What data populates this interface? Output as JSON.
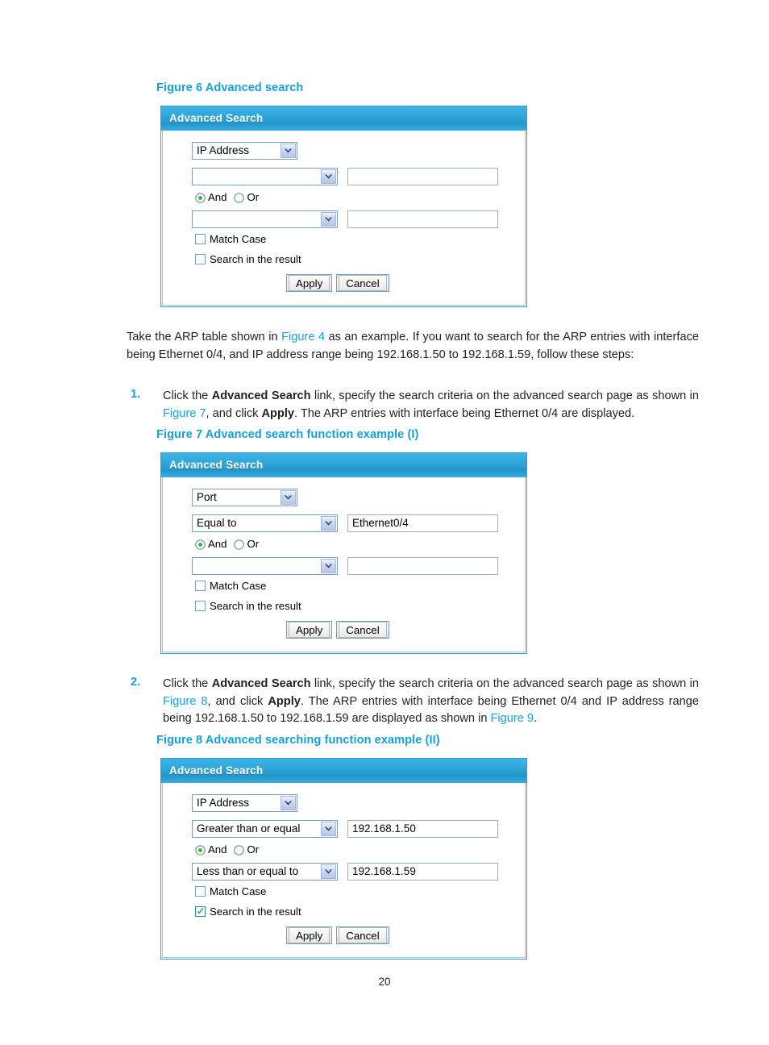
{
  "page": {
    "number": "20"
  },
  "figure6": {
    "caption": "Figure 6 Advanced search",
    "panel": {
      "title": "Advanced Search",
      "field_select": "IP Address",
      "operator1": "",
      "value1": "",
      "logic": {
        "and_label": "And",
        "or_label": "Or",
        "selected": "And"
      },
      "operator2": "",
      "value2": "",
      "match_case": {
        "label": "Match Case",
        "checked": false
      },
      "search_in_result": {
        "label": "Search in the result",
        "checked": false
      },
      "apply_label": "Apply",
      "cancel_label": "Cancel"
    }
  },
  "paragraph1": {
    "part1": "Take the ARP table shown in ",
    "link1": "Figure 4",
    "part2": " as an example. If you want to search for the ARP entries with interface being Ethernet 0/4, and IP address range being 192.168.1.50 to 192.168.1.59, follow these steps:"
  },
  "step1": {
    "number": "1.",
    "part1": "Click the ",
    "bold1": "Advanced Search",
    "part2": " link, specify the search criteria on the advanced search page as shown in ",
    "link1": "Figure 7",
    "part3": ", and click ",
    "bold2": "Apply",
    "part4": ". The ARP entries with interface being Ethernet 0/4 are displayed."
  },
  "figure7": {
    "caption": "Figure 7 Advanced search function example (I)",
    "panel": {
      "title": "Advanced Search",
      "field_select": "Port",
      "operator1": "Equal to",
      "value1": "Ethernet0/4",
      "logic": {
        "and_label": "And",
        "or_label": "Or",
        "selected": "And"
      },
      "operator2": "",
      "value2": "",
      "match_case": {
        "label": "Match Case",
        "checked": false
      },
      "search_in_result": {
        "label": "Search in the result",
        "checked": false
      },
      "apply_label": "Apply",
      "cancel_label": "Cancel"
    }
  },
  "step2": {
    "number": "2.",
    "part1": "Click the ",
    "bold1": "Advanced Search",
    "part2": " link, specify the search criteria on the advanced search page as shown in ",
    "link1": "Figure 8",
    "part3": ", and click ",
    "bold2": "Apply",
    "part4": ". The ARP entries with interface being Ethernet 0/4 and IP address range being 192.168.1.50 to 192.168.1.59 are displayed as shown in ",
    "link2": "Figure 9",
    "part5": "."
  },
  "figure8": {
    "caption": "Figure 8 Advanced searching function example (II)",
    "panel": {
      "title": "Advanced Search",
      "field_select": "IP Address",
      "operator1": "Greater than or equal",
      "value1": "192.168.1.50",
      "logic": {
        "and_label": "And",
        "or_label": "Or",
        "selected": "And"
      },
      "operator2": "Less than or equal to",
      "value2": "192.168.1.59",
      "match_case": {
        "label": "Match Case",
        "checked": false
      },
      "search_in_result": {
        "label": "Search in the result",
        "checked": true
      },
      "apply_label": "Apply",
      "cancel_label": "Cancel"
    }
  },
  "colors": {
    "accent_blue": "#13a1dc",
    "header_blue": "#2ba5d8",
    "radio_green": "#2eb82e",
    "text": "#231f20"
  }
}
